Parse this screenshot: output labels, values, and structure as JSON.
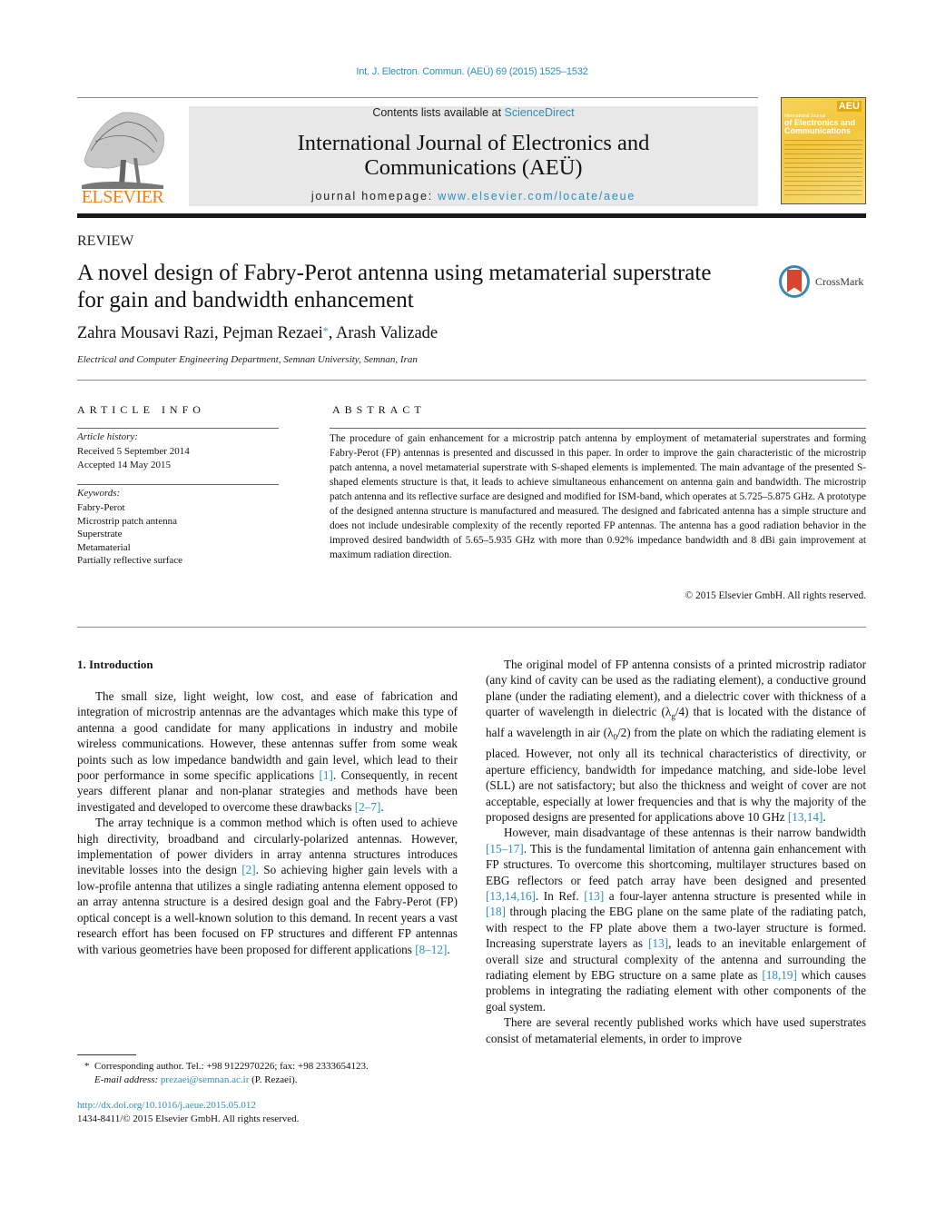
{
  "header": {
    "citation": "Int. J. Electron. Commun. (AEÜ) 69 (2015) 1525–1532",
    "contents_prefix": "Contents lists available at ",
    "contents_link": "ScienceDirect",
    "journal_title_line1": "International Journal of Electronics and",
    "journal_title_line2": "Communications (AEÜ)",
    "homepage_prefix": "journal homepage: ",
    "homepage_link": "www.elsevier.com/locate/aeue",
    "publisher_logo_text": "ELSEVIER",
    "cover": {
      "badge": "AEÜ",
      "small_title": "International Journal",
      "big_title_line1": "of Electronics and",
      "big_title_line2": "Communications"
    },
    "colors": {
      "link": "#2b8fc0",
      "elsevier_orange": "#f07f1b",
      "masthead_bg": "#e8e8e8"
    }
  },
  "article": {
    "type_label": "REVIEW",
    "title_line1": "A novel design of Fabry-Perot antenna using metamaterial superstrate",
    "title_line2": "for gain and bandwidth enhancement",
    "crossmark_label": "CrossMark",
    "authors": [
      {
        "name": "Zahra Mousavi Razi",
        "corresponding": false
      },
      {
        "name": "Pejman Rezaei",
        "corresponding": true
      },
      {
        "name": "Arash Valizade",
        "corresponding": false
      }
    ],
    "affiliation": "Electrical and Computer Engineering Department, Semnan University, Semnan, Iran"
  },
  "article_info": {
    "heading": "ARTICLE INFO",
    "history_label": "Article history:",
    "history": [
      "Received 5 September 2014",
      "Accepted 14 May 2015"
    ],
    "keywords_label": "Keywords:",
    "keywords": [
      "Fabry-Perot",
      "Microstrip patch antenna",
      "Superstrate",
      "Metamaterial",
      "Partially reflective surface"
    ]
  },
  "abstract": {
    "heading": "ABSTRACT",
    "text": "The procedure of gain enhancement for a microstrip patch antenna by employment of metamaterial superstrates and forming Fabry-Perot (FP) antennas is presented and discussed in this paper. In order to improve the gain characteristic of the microstrip patch antenna, a novel metamaterial superstrate with S-shaped elements is implemented. The main advantage of the presented S-shaped elements structure is that, it leads to achieve simultaneous enhancement on antenna gain and bandwidth. The microstrip patch antenna and its reflective surface are designed and modified for ISM-band, which operates at 5.725–5.875 GHz. A prototype of the designed antenna structure is manufactured and measured. The designed and fabricated antenna has a simple structure and does not include undesirable complexity of the recently reported FP antennas. The antenna has a good radiation behavior in the improved desired bandwidth of 5.65–5.935 GHz with more than 0.92% impedance bandwidth and 8 dBi gain improvement at maximum radiation direction.",
    "copyright": "© 2015 Elsevier GmbH. All rights reserved."
  },
  "body": {
    "section_heading": "1.  Introduction",
    "left_paragraphs": [
      [
        {
          "t": "The small size, light weight, low cost, and ease of fabrication and integration of microstrip antennas are the advantages which make this type of antenna a good candidate for many applications in industry and mobile wireless communications. However, these antennas suffer from some weak points such as low impedance bandwidth and gain level, which lead to their poor performance in some specific applications "
        },
        {
          "ref": "[1]"
        },
        {
          "t": ". Consequently, in recent years different planar and non-planar strategies and methods have been investigated and developed to overcome these drawbacks "
        },
        {
          "ref": "[2–7]"
        },
        {
          "t": "."
        }
      ],
      [
        {
          "t": "The array technique is a common method which is often used to achieve high directivity, broadband and circularly-polarized antennas. However, implementation of power dividers in array antenna structures introduces inevitable losses into the design "
        },
        {
          "ref": "[2]"
        },
        {
          "t": ". So achieving higher gain levels with a low-profile antenna that utilizes a single radiating antenna element opposed to an array antenna structure is a desired design goal and the Fabry-Perot (FP) optical concept is a well-known solution to this demand. In recent years a vast research effort has been focused on FP structures and different FP antennas with various geometries have been proposed for different applications "
        },
        {
          "ref": "[8–12]"
        },
        {
          "t": "."
        }
      ]
    ],
    "right_paragraphs": [
      [
        {
          "t": "The original model of FP antenna consists of a printed microstrip radiator (any kind of cavity can be used as the radiating element), a conductive ground plane (under the radiating element), and a dielectric cover with thickness of a quarter of wavelength in dielectric (λ"
        },
        {
          "sub": "g"
        },
        {
          "t": "/4) that is located with the distance of half a wavelength in air (λ"
        },
        {
          "sub": "0"
        },
        {
          "t": "/2) from the plate on which the radiating element is placed. However, not only all its technical characteristics of directivity, or aperture efficiency, bandwidth for impedance matching, and side-lobe level (SLL) are not satisfactory; but also the thickness and weight of cover are not acceptable, especially at lower frequencies and that is why the majority of the proposed designs are presented for applications above 10 GHz "
        },
        {
          "ref": "[13,14]"
        },
        {
          "t": "."
        }
      ],
      [
        {
          "t": "However, main disadvantage of these antennas is their narrow bandwidth "
        },
        {
          "ref": "[15–17]"
        },
        {
          "t": ". This is the fundamental limitation of antenna gain enhancement with FP structures. To overcome this shortcoming, multilayer structures based on EBG reflectors or feed patch array have been designed and presented "
        },
        {
          "ref": "[13,14,16]"
        },
        {
          "t": ". In Ref. "
        },
        {
          "ref": "[13]"
        },
        {
          "t": " a four-layer antenna structure is presented while in "
        },
        {
          "ref": "[18]"
        },
        {
          "t": " through placing the EBG plane on the same plate of the radiating patch, with respect to the FP plate above them a two-layer structure is formed. Increasing superstrate layers as "
        },
        {
          "ref": "[13]"
        },
        {
          "t": ", leads to an inevitable enlargement of overall size and structural complexity of the antenna and surrounding the radiating element by EBG structure on a same plate as "
        },
        {
          "ref": "[18,19]"
        },
        {
          "t": " which causes problems in integrating the radiating element with other components of the goal system."
        }
      ],
      [
        {
          "t": "There are several recently published works which have used superstrates consist of metamaterial elements, in order to improve"
        }
      ]
    ]
  },
  "footer": {
    "footnote_star": "*",
    "footnote_line1": "Corresponding author. Tel.: +98 9122970226; fax: +98 2333654123.",
    "email_label": "E-mail address: ",
    "email": "prezaei@semnan.ac.ir",
    "email_suffix": " (P. Rezaei).",
    "doi": "http://dx.doi.org/10.1016/j.aeue.2015.05.012",
    "issn_line": "1434-8411/© 2015 Elsevier GmbH. All rights reserved."
  }
}
